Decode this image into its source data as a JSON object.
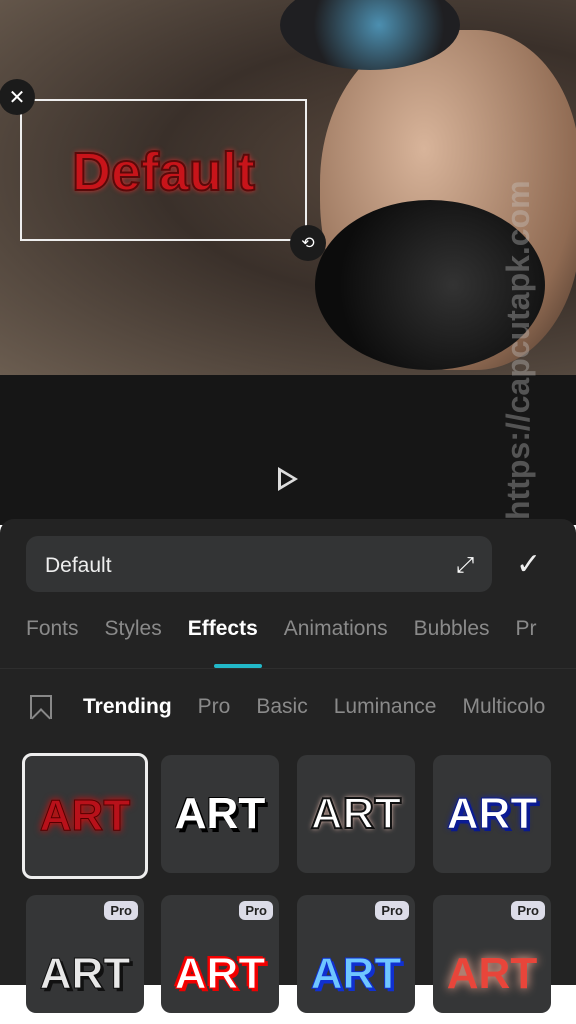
{
  "canvas": {
    "text": "Default"
  },
  "player": {
    "play_icon": "play-icon"
  },
  "editor": {
    "input_value": "Default",
    "expand_icon": "expand-icon",
    "confirm_icon": "check-icon"
  },
  "tabs": [
    {
      "label": "Fonts"
    },
    {
      "label": "Styles"
    },
    {
      "label": "Effects",
      "active": true
    },
    {
      "label": "Animations"
    },
    {
      "label": "Bubbles"
    },
    {
      "label": "Pr"
    }
  ],
  "subtabs": [
    {
      "label": "Trending",
      "active": true
    },
    {
      "label": "Pro"
    },
    {
      "label": "Basic"
    },
    {
      "label": "Luminance"
    },
    {
      "label": "Multicolo"
    }
  ],
  "effects": [
    {
      "label": "ART",
      "color": "#b8111a",
      "pro": false,
      "selected": true
    },
    {
      "label": "ART",
      "color": "#ffffff",
      "pro": false
    },
    {
      "label": "ART",
      "color": "#ffffff",
      "pro": false
    },
    {
      "label": "ART",
      "color": "#ffffff",
      "pro": false
    },
    {
      "label": "ART",
      "color": "#e8e8e8",
      "pro": true,
      "badge": "Pro"
    },
    {
      "label": "ART",
      "color": "#ffffff",
      "pro": true,
      "badge": "Pro"
    },
    {
      "label": "ART",
      "color": "#6fc6ff",
      "pro": true,
      "badge": "Pro"
    },
    {
      "label": "ART",
      "color": "#e8453a",
      "pro": true,
      "badge": "Pro"
    }
  ],
  "watermark": "https://capcutapk.com"
}
